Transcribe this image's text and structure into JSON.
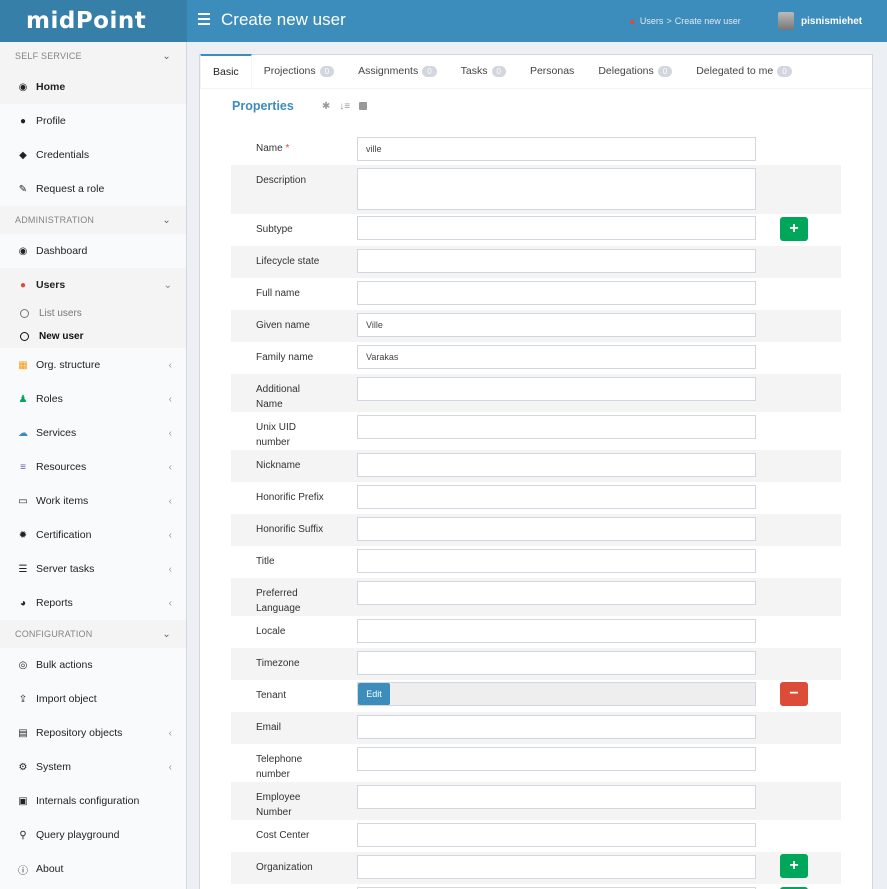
{
  "app": {
    "logo": "midPoint",
    "page_title": "Create new user"
  },
  "breadcrumb": {
    "users": "Users",
    "separator": ">",
    "current": "Create new user"
  },
  "user_menu": {
    "username": "pisnismiehet"
  },
  "sidebar": {
    "self_service": "SELF SERVICE",
    "self_service_items": [
      {
        "label": "Home",
        "icon": "dashboard-icon"
      },
      {
        "label": "Profile",
        "icon": "user-icon"
      },
      {
        "label": "Credentials",
        "icon": "shield-icon"
      },
      {
        "label": "Request a role",
        "icon": "edit-icon"
      }
    ],
    "administration": "ADMINISTRATION",
    "admin_items": {
      "dashboard": "Dashboard",
      "users": "Users",
      "list_users": "List users",
      "new_user": "New user",
      "org_structure": "Org. structure",
      "roles": "Roles",
      "services": "Services",
      "resources": "Resources",
      "work_items": "Work items",
      "certification": "Certification",
      "server_tasks": "Server tasks",
      "reports": "Reports"
    },
    "configuration": "CONFIGURATION",
    "config_items": {
      "bulk_actions": "Bulk actions",
      "import_object": "Import object",
      "repository_objects": "Repository objects",
      "system": "System",
      "internals_configuration": "Internals configuration",
      "query_playground": "Query playground",
      "about": "About"
    }
  },
  "tabs": [
    {
      "label": "Basic",
      "count": null
    },
    {
      "label": "Projections",
      "count": "0"
    },
    {
      "label": "Assignments",
      "count": "0"
    },
    {
      "label": "Tasks",
      "count": "0"
    },
    {
      "label": "Personas",
      "count": null
    },
    {
      "label": "Delegations",
      "count": "0"
    },
    {
      "label": "Delegated to me",
      "count": "0"
    }
  ],
  "properties": {
    "title": "Properties",
    "fields": {
      "name": {
        "label": "Name",
        "required": "*",
        "value": "ville"
      },
      "description": {
        "label": "Description",
        "value": ""
      },
      "subtype": {
        "label": "Subtype",
        "value": ""
      },
      "lifecycle_state": {
        "label": "Lifecycle state",
        "value": ""
      },
      "full_name": {
        "label": "Full name",
        "value": ""
      },
      "given_name": {
        "label": "Given name",
        "value": "Ville"
      },
      "family_name": {
        "label": "Family name",
        "value": "Varakas"
      },
      "additional_name": {
        "label": "Additional Name",
        "value": ""
      },
      "unix_uid": {
        "label": "Unix UID number",
        "value": ""
      },
      "nickname": {
        "label": "Nickname",
        "value": ""
      },
      "honorific_prefix": {
        "label": "Honorific Prefix",
        "value": ""
      },
      "honorific_suffix": {
        "label": "Honorific Suffix",
        "value": ""
      },
      "title": {
        "label": "Title",
        "value": ""
      },
      "preferred_language": {
        "label": "Preferred Language",
        "value": ""
      },
      "locale": {
        "label": "Locale",
        "value": ""
      },
      "timezone": {
        "label": "Timezone",
        "value": ""
      },
      "tenant": {
        "label": "Tenant",
        "edit": "Edit"
      },
      "email": {
        "label": "Email",
        "value": ""
      },
      "telephone": {
        "label": "Telephone number",
        "value": ""
      },
      "employee_number": {
        "label": "Employee Number",
        "value": ""
      },
      "cost_center": {
        "label": "Cost Center",
        "value": ""
      },
      "organization": {
        "label": "Organization",
        "value": ""
      }
    },
    "add_symbol": "+",
    "remove_symbol": "−"
  },
  "colors": {
    "header": "#3c8dbc",
    "logo_bg": "#367fa9",
    "add": "#00a65a",
    "remove": "#dd4b39"
  }
}
